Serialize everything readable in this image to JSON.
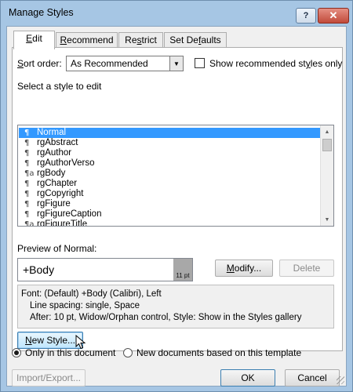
{
  "window": {
    "title": "Manage Styles",
    "help_glyph": "?",
    "close_glyph": "✕"
  },
  "tabs": [
    {
      "pre": "",
      "key": "E",
      "post": "dit"
    },
    {
      "pre": "",
      "key": "R",
      "post": "ecommend"
    },
    {
      "pre": "Re",
      "key": "s",
      "post": "trict"
    },
    {
      "pre": "Set De",
      "key": "f",
      "post": "aults"
    }
  ],
  "sort": {
    "label_pre": "",
    "label_key": "S",
    "label_post": "ort order:",
    "value": "As Recommended",
    "show_recommended_pre": "Show recommended st",
    "show_recommended_key": "y",
    "show_recommended_post": "les only",
    "show_recommended_checked": false
  },
  "select_label": "Select a style to edit",
  "styles": [
    {
      "icon": "¶",
      "label": "Normal",
      "selected": true
    },
    {
      "icon": "¶",
      "label": "rgAbstract"
    },
    {
      "icon": "¶",
      "label": "rgAuthor"
    },
    {
      "icon": "¶",
      "label": "rgAuthorVerso"
    },
    {
      "icon": "¶a",
      "label": "rgBody"
    },
    {
      "icon": "¶",
      "label": "rgChapter"
    },
    {
      "icon": "¶",
      "label": "rgCopyright"
    },
    {
      "icon": "¶",
      "label": "rgFigure"
    },
    {
      "icon": "¶",
      "label": "rgFigureCaption"
    },
    {
      "icon": "¶a",
      "label": "rgFigureTitle"
    }
  ],
  "preview": {
    "label": "Preview of Normal:",
    "text": "+Body",
    "size": "11 pt"
  },
  "buttons": {
    "modify_key": "M",
    "modify_post": "odify...",
    "delete": "Delete",
    "new_style_key": "N",
    "new_style_post": "ew Style...",
    "import_export": "Import/Export...",
    "ok": "OK",
    "cancel": "Cancel"
  },
  "description": [
    "Font: (Default) +Body (Calibri), Left",
    "Line spacing:  single, Space",
    "After:  10 pt, Widow/Orphan control, Style: Show in the Styles gallery"
  ],
  "scope": {
    "only_doc": "Only in this document",
    "new_docs": "New documents based on this template",
    "selected": "only_doc"
  }
}
